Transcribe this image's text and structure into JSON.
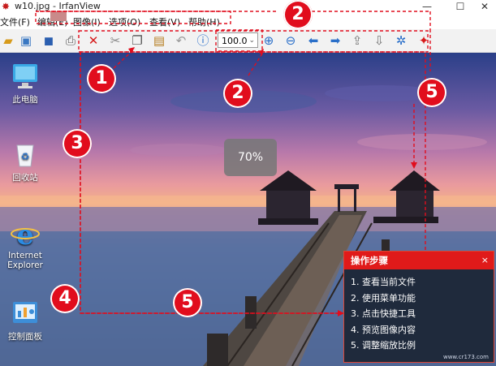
{
  "window": {
    "title": "w10.jpg - IrfanView",
    "controls": [
      "—",
      "☐",
      "✕"
    ]
  },
  "menu": {
    "items": [
      "文件(F)",
      "编辑(E)",
      "图像(I)",
      "选项(O)",
      "查看(V)",
      "帮助(H)"
    ]
  },
  "toolbar": {
    "zoom_value": "100.0",
    "icons": [
      "open-folder-icon",
      "slideshow-icon",
      "save-icon",
      "print-icon",
      "delete-icon",
      "cut-icon",
      "copy-icon",
      "paste-icon",
      "undo-icon",
      "info-icon",
      "zoom-in-icon",
      "zoom-out-icon",
      "previous-icon",
      "next-icon",
      "page-up-icon",
      "page-down-icon",
      "settings-icon",
      "exit-icon"
    ]
  },
  "desktop": {
    "icons": [
      {
        "label": "此电脑",
        "icon": "computer-icon"
      },
      {
        "label": "回收站",
        "icon": "recycle-bin-icon"
      },
      {
        "label": "Internet\nExplorer",
        "icon": "internet-explorer-icon"
      },
      {
        "label": "控制面板",
        "icon": "control-panel-icon"
      }
    ]
  },
  "annotations": {
    "badges": [
      "1",
      "2",
      "2",
      "3",
      "4",
      "5",
      "5"
    ],
    "zoom_pill": "70%"
  },
  "steps_panel": {
    "title": "操作步骤",
    "close": "×",
    "items": [
      "1. 查看当前文件",
      "2. 使用菜单功能",
      "3. 点击快捷工具",
      "4. 预览图像内容",
      "5. 调整缩放比例"
    ],
    "watermark": "www.cr173.com"
  },
  "colors": {
    "accent_red": "#e10d1d",
    "panel_bg": "#1f2a3c",
    "dashed_line": "#e10d1d"
  }
}
